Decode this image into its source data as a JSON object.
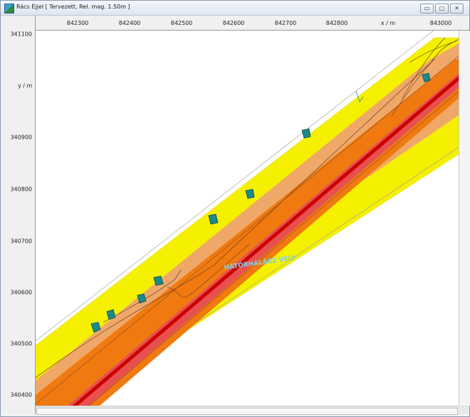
{
  "window": {
    "title": "Rács Éjjel  [ Tervezett, Rel. mag. 1.50m ]",
    "buttons": {
      "minimize": "▭",
      "maximize": "▢",
      "close": "✕"
    }
  },
  "x_axis": {
    "label": "x / m",
    "ticks": [
      "842300",
      "842400",
      "842500",
      "842600",
      "842700",
      "842800",
      "843000"
    ]
  },
  "y_axis": {
    "label": "y / m",
    "ticks": [
      "341100",
      "340900",
      "340800",
      "340700",
      "340600",
      "340500",
      "340400"
    ]
  },
  "map": {
    "road_label": "HATÓRHALÁSZ VELY",
    "colors": {
      "background": "#ffffff",
      "outer_band": "#f4f000",
      "mid_band": "#f0a868",
      "inner_band": "#f07a10",
      "core_band": "#e85050",
      "center_line": "#cc0000",
      "buildings": "#1a8a8a"
    }
  }
}
